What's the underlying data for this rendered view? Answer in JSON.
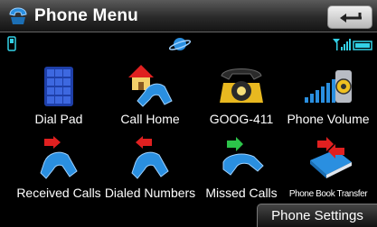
{
  "header": {
    "title": "Phone Menu"
  },
  "menu": {
    "items": [
      {
        "label": "Dial Pad"
      },
      {
        "label": "Call Home"
      },
      {
        "label": "GOOG-411"
      },
      {
        "label": "Phone Volume"
      },
      {
        "label": "Received Calls"
      },
      {
        "label": "Dialed Numbers"
      },
      {
        "label": "Missed Calls"
      },
      {
        "label": "Phone Book Transfer"
      }
    ]
  },
  "footer": {
    "settings_label": "Phone Settings"
  },
  "colors": {
    "accent_blue": "#2a8fe0",
    "arrow_red": "#e02020",
    "arrow_green": "#2cc44a",
    "status_cyan": "#33d1e6"
  }
}
